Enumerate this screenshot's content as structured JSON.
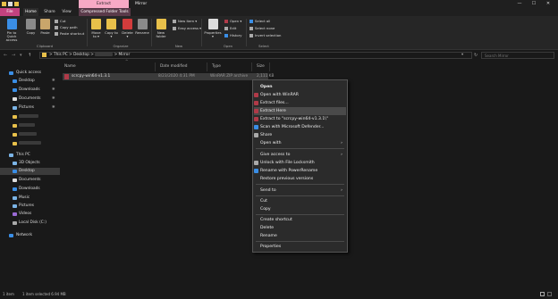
{
  "window": {
    "context_tab_header": "Extract",
    "title": "Mirror",
    "min_glyph": "—",
    "max_glyph": "☐",
    "close_glyph": "✕"
  },
  "tabs": {
    "file": "File",
    "home": "Home",
    "share": "Share",
    "view": "View",
    "compressed": "Compressed Folder Tools"
  },
  "ribbon": {
    "pin": "Pin to Quick access",
    "copy": "Copy",
    "paste": "Paste",
    "cut": "Cut",
    "copy_path": "Copy path",
    "paste_shortcut": "Paste shortcut",
    "move_to": "Move to ▾",
    "copy_to": "Copy to ▾",
    "delete": "Delete ▾",
    "rename": "Rename",
    "new_folder": "New folder",
    "new_item": "New item ▾",
    "easy_access": "Easy access ▾",
    "properties": "Properties ▾",
    "open": "Open ▾",
    "edit": "Edit",
    "history": "History",
    "select_all": "Select all",
    "select_none": "Select none",
    "invert_selection": "Invert selection",
    "groups": {
      "clipboard": "Clipboard",
      "organize": "Organize",
      "new": "New",
      "open": "Open",
      "select": "Select"
    }
  },
  "address": {
    "back": "←",
    "forward": "→",
    "recent": "▾",
    "up": "↑",
    "path": [
      "This PC",
      "Desktop",
      "Mirror"
    ],
    "sep": ">",
    "dropdown": "▾",
    "refresh": "↻",
    "search_placeholder": "Search Mirror"
  },
  "nav": {
    "quick_access": "Quick access",
    "desktop": "Desktop",
    "downloads": "Downloads",
    "documents": "Documents",
    "pictures": "Pictures",
    "this_pc": "This PC",
    "objects_3d": "3D Objects",
    "desktop2": "Desktop",
    "documents2": "Documents",
    "downloads2": "Downloads",
    "music": "Music",
    "pictures2": "Pictures",
    "videos": "Videos",
    "local_disk": "Local Disk (C:)",
    "network": "Network"
  },
  "columns": {
    "name": "Name",
    "date": "Date modified",
    "type": "Type",
    "size": "Size",
    "sort_glyph": "^"
  },
  "file": {
    "name": "scrcpy-win64-v1.3.1",
    "date": "8/23/2020 4:31 PM",
    "type": "WinRAR ZIP archive",
    "size": "2,111 KB"
  },
  "status": {
    "count": "1 item",
    "selected": "1 item selected  6.94 MB"
  },
  "context_menu": {
    "open": "Open",
    "open_winrar": "Open with WinRAR",
    "extract_files": "Extract files...",
    "extract_here": "Extract Here",
    "extract_to": "Extract to \"scrcpy-win64-v1.3.1\\\"",
    "scan_defender": "Scan with Microsoft Defender...",
    "share": "Share",
    "open_with": "Open with",
    "give_access": "Give access to",
    "unlock": "Unlock with File Locksmith",
    "rename_power": "Rename with PowerRename",
    "restore": "Restore previous versions",
    "send_to": "Send to",
    "cut": "Cut",
    "copy": "Copy",
    "create_shortcut": "Create shortcut",
    "delete": "Delete",
    "rename": "Rename",
    "properties": "Properties",
    "arrow_glyph": "›"
  },
  "colors": {
    "file_tab": "#c3427f",
    "context_tab": "#f7a9c5",
    "folder": "#e8c04a",
    "winrar": "#b03a48",
    "accent_blue": "#3a8ee6"
  }
}
